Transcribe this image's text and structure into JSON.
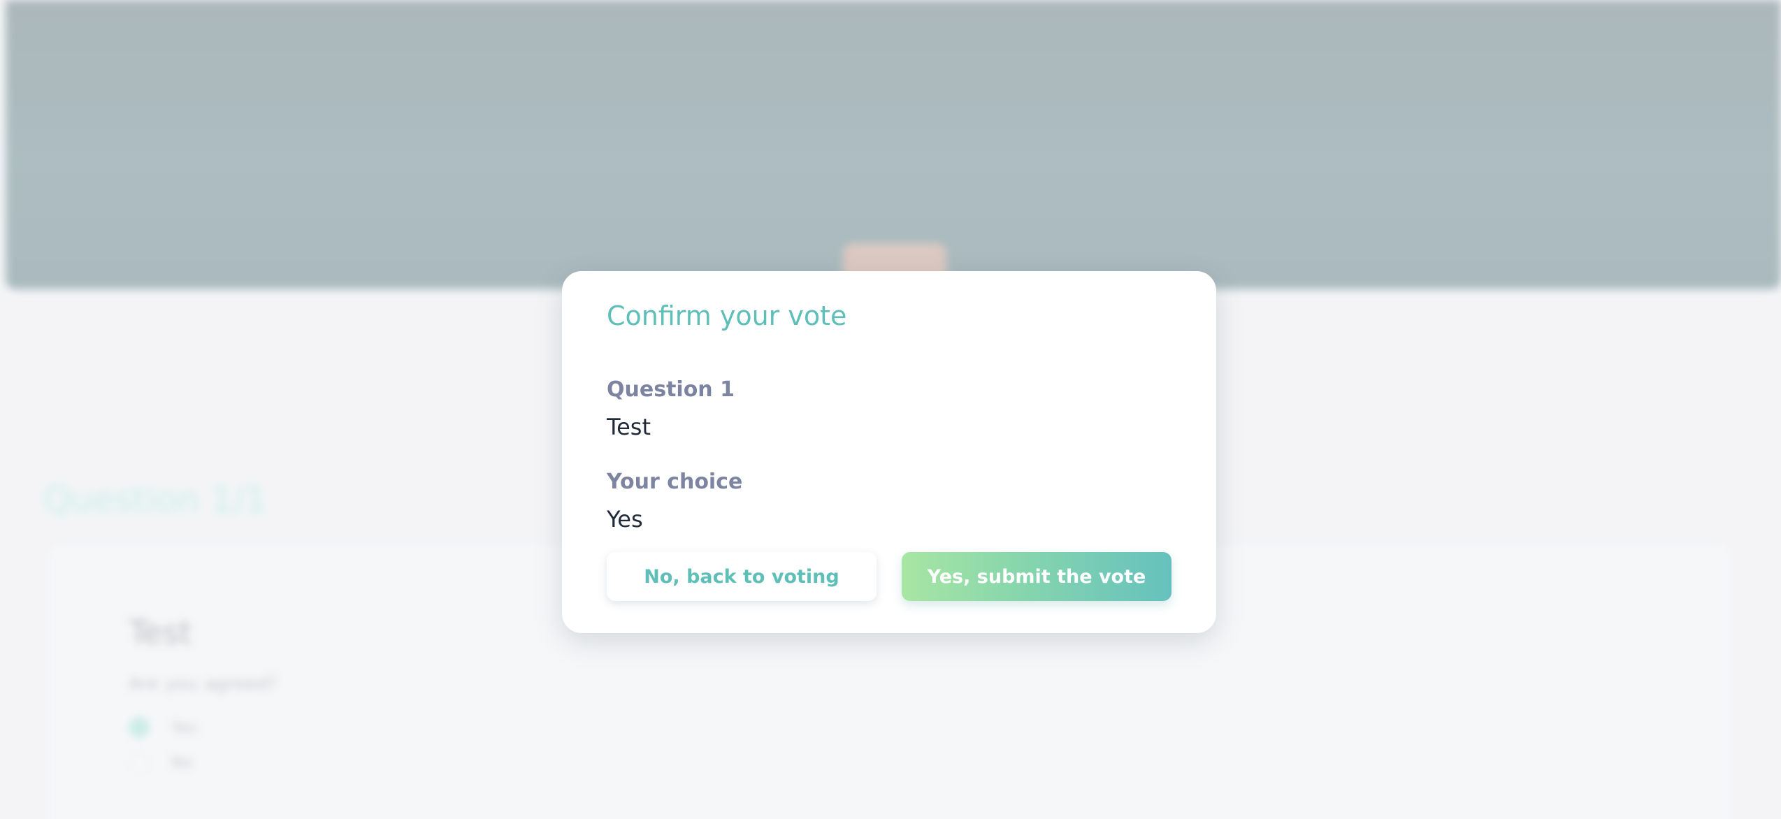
{
  "background": {
    "question_heading": "Question 1/1",
    "card": {
      "title": "Test",
      "subtitle": "Are you agreed?",
      "options": [
        {
          "label": "Yes",
          "selected": true
        },
        {
          "label": "No",
          "selected": false
        }
      ]
    }
  },
  "modal": {
    "title": "Confirm your vote",
    "question_label": "Question 1",
    "question_value": "Test",
    "choice_label": "Your choice",
    "choice_value": "Yes",
    "back_button": "No, back to voting",
    "submit_button": "Yes, submit the vote"
  },
  "colors": {
    "accent": "#5dbfb8",
    "label": "#7d84a1",
    "submit_gradient_start": "#a8e6a3",
    "submit_gradient_end": "#66c1be"
  }
}
